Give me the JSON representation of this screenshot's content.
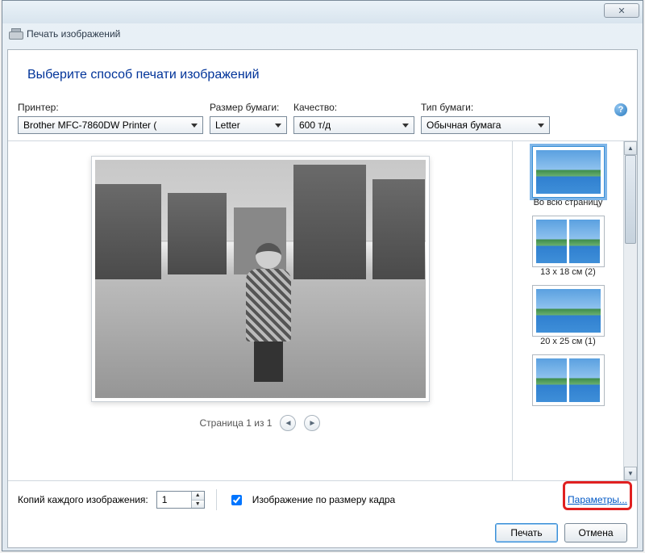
{
  "window": {
    "close_glyph": "✕",
    "app_title": "Печать изображений"
  },
  "heading": "Выберите способ печати изображений",
  "labels": {
    "printer": "Принтер:",
    "paper_size": "Размер бумаги:",
    "quality": "Качество:",
    "paper_type": "Тип бумаги:"
  },
  "selects": {
    "printer": "Brother MFC-7860DW Printer (",
    "paper_size": "Letter",
    "quality": "600 т/д",
    "paper_type": "Обычная бумага"
  },
  "help_glyph": "?",
  "pager": {
    "text": "Страница 1 из 1",
    "prev_glyph": "◄",
    "next_glyph": "►"
  },
  "layouts": [
    {
      "label": "Во всю страницу",
      "style": "full",
      "selected": true
    },
    {
      "label": "13 x 18 см (2)",
      "style": "two",
      "selected": false
    },
    {
      "label": "20 x 25 см (1)",
      "style": "full",
      "selected": false
    },
    {
      "label": "",
      "style": "two",
      "selected": false
    }
  ],
  "scroll": {
    "up_glyph": "▲",
    "down_glyph": "▼"
  },
  "footer": {
    "copies_label": "Копий каждого изображения:",
    "copies_value": "1",
    "fit_label": "Изображение по размеру кадра",
    "fit_checked": true,
    "options_link": "Параметры..."
  },
  "buttons": {
    "print": "Печать",
    "cancel": "Отмена"
  }
}
